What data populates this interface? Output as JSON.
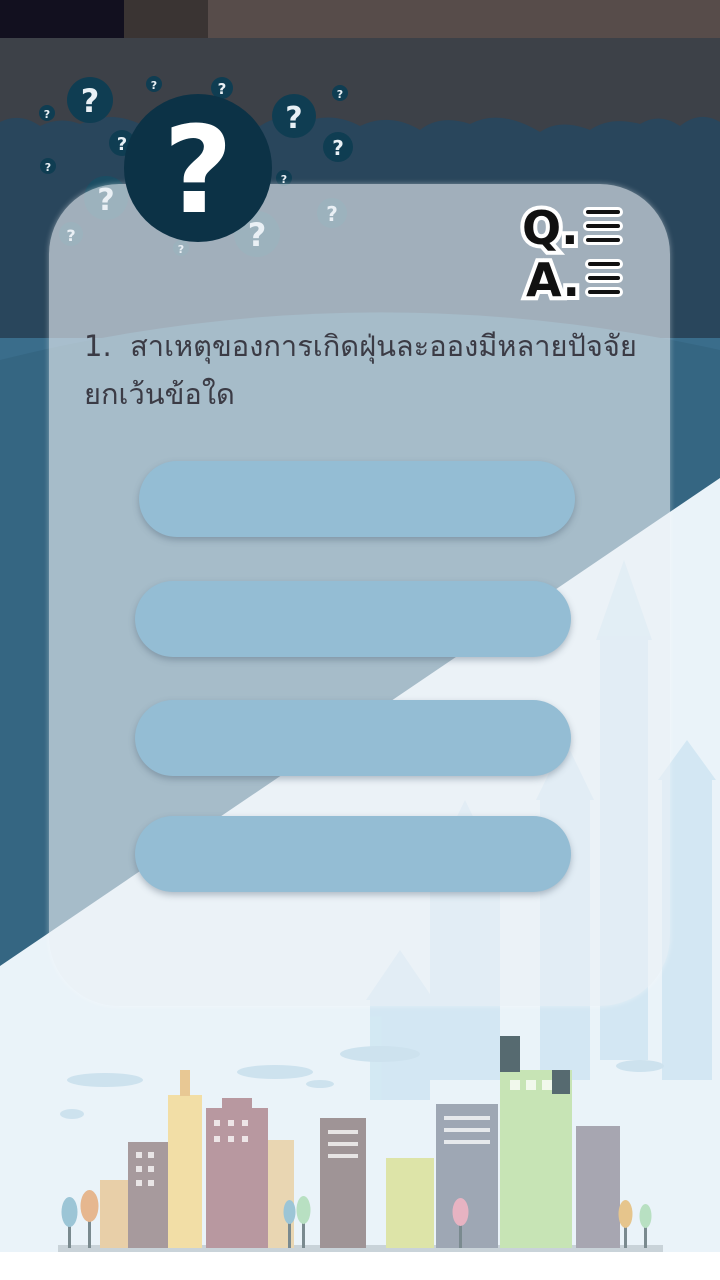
{
  "question": {
    "number": "1.",
    "text": "สาเหตุของการเกิดฝุ่นละอองมีหลายปัจจัย ยกเว้นข้อใด"
  },
  "answers": [
    {
      "label": ""
    },
    {
      "label": ""
    },
    {
      "label": ""
    },
    {
      "label": ""
    }
  ],
  "icons": {
    "logo": "qa-logo-icon",
    "hero": "question-mark-bubble-icon"
  },
  "colors": {
    "answer_button": "#94bdd4",
    "dark_navy": "#0c3246",
    "sky_top": "#2d4a60",
    "sky_mid": "#346780",
    "light_area": "#eaf3f9"
  }
}
